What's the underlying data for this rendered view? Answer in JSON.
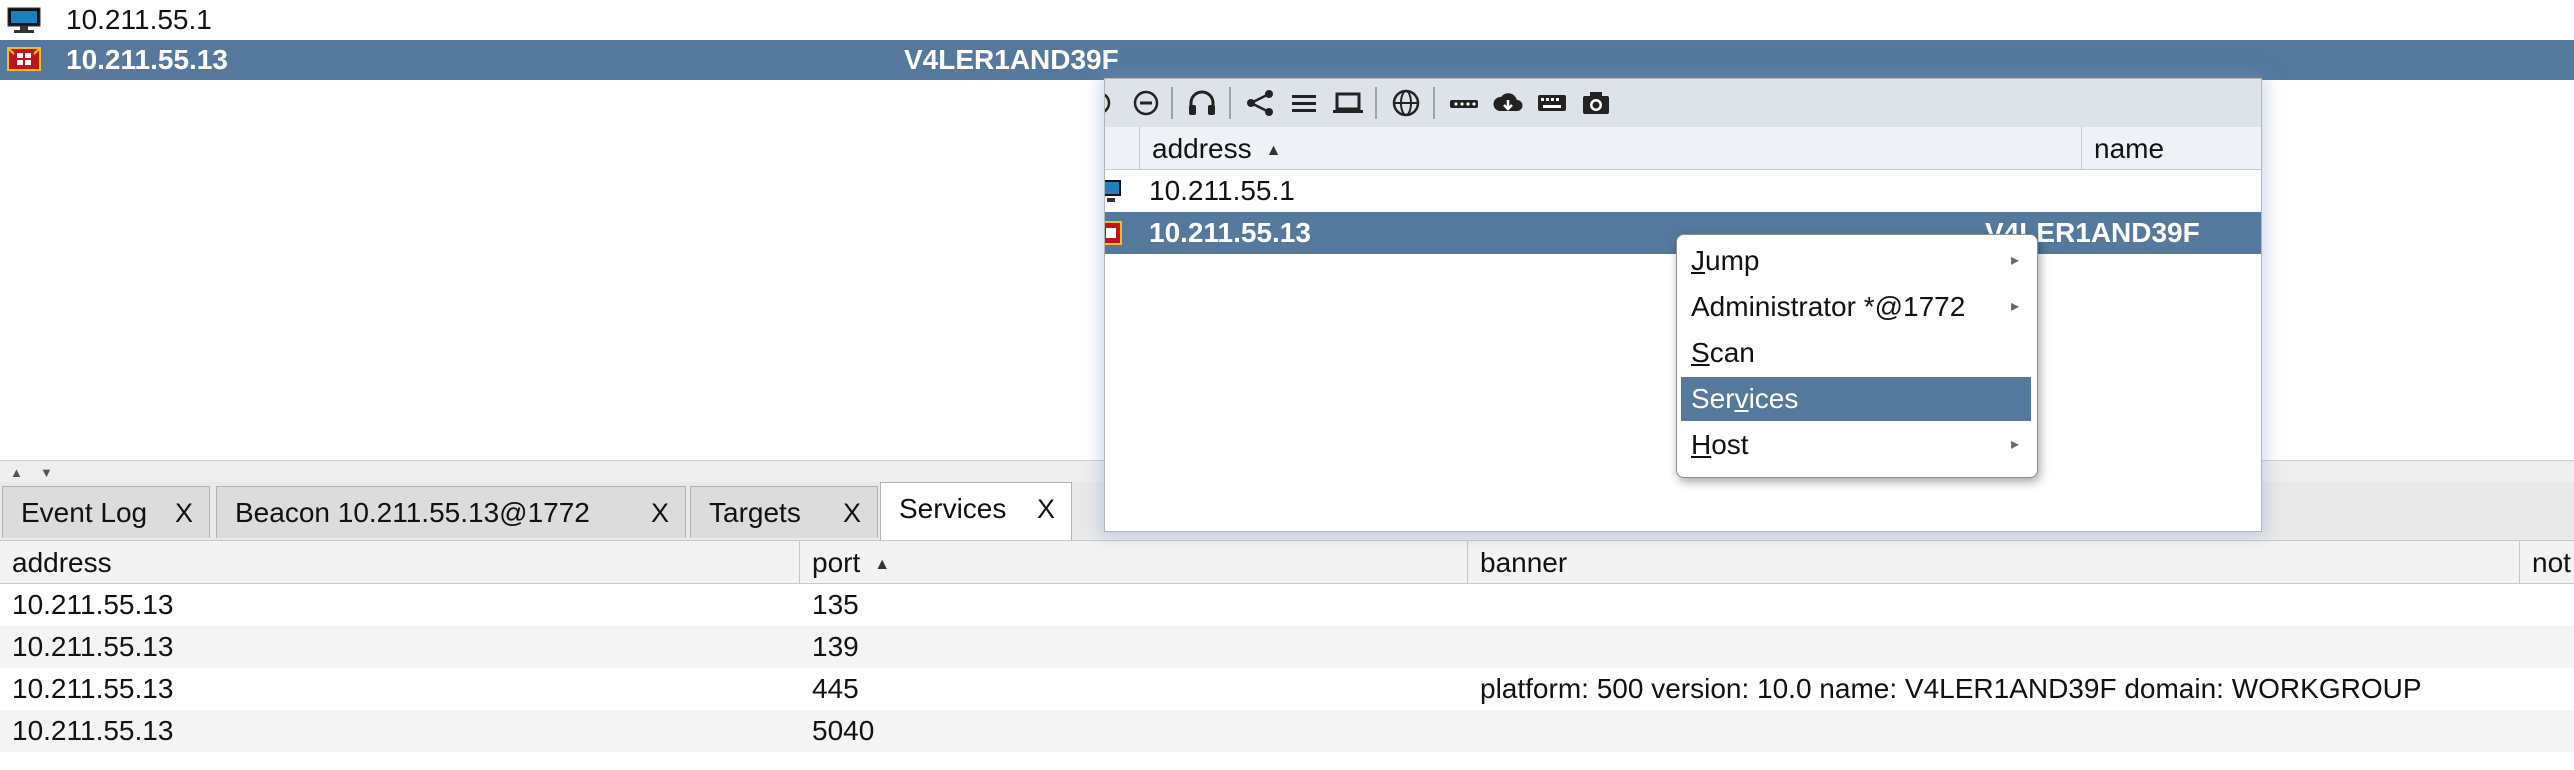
{
  "targets_top": {
    "rows": [
      {
        "address": "10.211.55.1",
        "name": "",
        "icon": "monitor-icon",
        "selected": false
      },
      {
        "address": "10.211.55.13",
        "name": "V4LER1AND39F",
        "icon": "windows-beacon-icon",
        "selected": true
      }
    ]
  },
  "tabs": [
    {
      "label": "Event Log",
      "close": "X"
    },
    {
      "label": "Beacon 10.211.55.13@1772",
      "close": "X"
    },
    {
      "label": "Targets",
      "close": "X"
    },
    {
      "label": "Services",
      "close": "X",
      "active": true
    }
  ],
  "services": {
    "columns": [
      "address",
      "port",
      "banner",
      "not"
    ],
    "sorted_column": "port",
    "rows": [
      {
        "address": "10.211.55.13",
        "port": "135",
        "banner": ""
      },
      {
        "address": "10.211.55.13",
        "port": "139",
        "banner": ""
      },
      {
        "address": "10.211.55.13",
        "port": "445",
        "banner": "platform: 500 version: 10.0 name: V4LER1AND39F domain: WORKGROUP"
      },
      {
        "address": "10.211.55.13",
        "port": "5040",
        "banner": ""
      }
    ]
  },
  "float_window": {
    "toolbar_icons": [
      "minus-circle-icon",
      "headphones-icon",
      "share-icon",
      "list-icon",
      "laptop-icon",
      "globe-icon",
      "dots-icon",
      "cloud-download-icon",
      "keyboard-icon",
      "camera-icon"
    ],
    "columns": [
      "address",
      "name"
    ],
    "sorted_column": "address",
    "rows": [
      {
        "address": "10.211.55.1",
        "name": "",
        "selected": false
      },
      {
        "address": "10.211.55.13",
        "name": "V4LER1AND39F",
        "selected": true
      }
    ]
  },
  "context_menu": {
    "items": [
      {
        "label": "Jump",
        "mnemonic": "J",
        "submenu": true
      },
      {
        "label": "Administrator *@1772",
        "mnemonic": "",
        "submenu": true
      },
      {
        "label": "Scan",
        "mnemonic": "S",
        "submenu": false
      },
      {
        "label": "Services",
        "mnemonic": "v",
        "submenu": false,
        "highlighted": true
      },
      {
        "label": "Host",
        "mnemonic": "H",
        "submenu": true
      }
    ]
  },
  "colors": {
    "selection": "#54799c",
    "header_bg": "#f3f3f3"
  }
}
